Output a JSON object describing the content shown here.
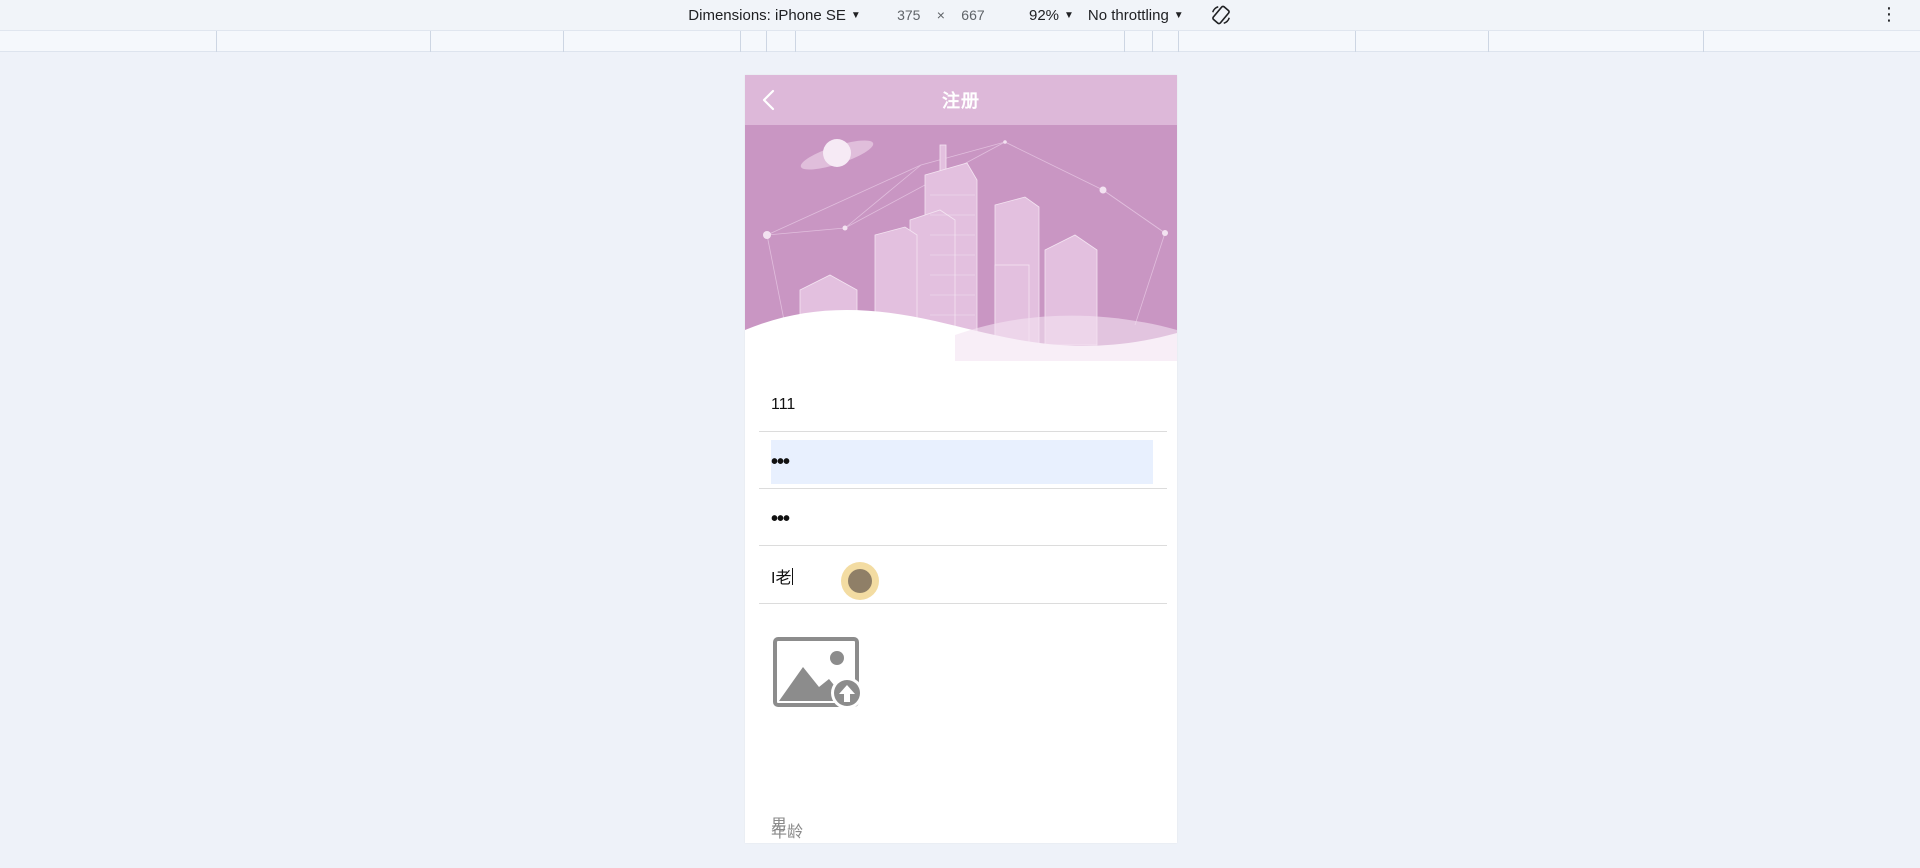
{
  "devtools": {
    "dimensions_label": "Dimensions: iPhone SE",
    "width": "375",
    "times": "×",
    "height": "667",
    "zoom": "92%",
    "throttling": "No throttling",
    "more_icon": "⋮"
  },
  "app": {
    "title": "注册",
    "back_icon": "chevron-left-icon",
    "banner_icon": "city-skyline-illustration"
  },
  "form": {
    "username_value": "111",
    "password_value": "•••",
    "confirm_password_value": "•••",
    "nickname_value": "I老",
    "upload_icon": "image-upload-icon",
    "gender_placeholder": "男",
    "age_placeholder": "年龄"
  },
  "colors": {
    "navbar": "#ddb8d9",
    "banner": "#c996c3",
    "focused_input": "#e8f0fe",
    "page_background": "#eef2f9"
  }
}
